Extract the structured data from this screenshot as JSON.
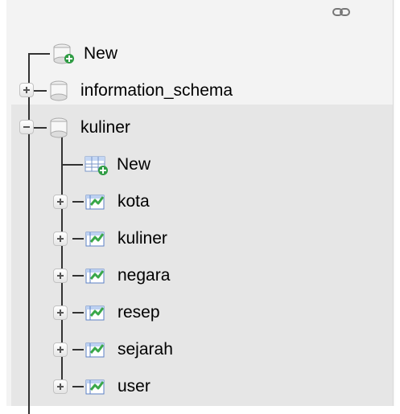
{
  "navigation_tree": {
    "link_icon": "link-chain-icon",
    "server_items": [
      {
        "label": "New",
        "icon": "new-database-icon"
      },
      {
        "label": "information_schema",
        "icon": "database-icon",
        "expander": "expand-plus"
      },
      {
        "label": "kuliner",
        "icon": "database-icon",
        "expander": "collapse-minus"
      }
    ],
    "database_items": [
      {
        "label": "New",
        "icon": "new-table-icon"
      },
      {
        "label": "kota",
        "icon": "table-icon",
        "expander": "expand-plus"
      },
      {
        "label": "kuliner",
        "icon": "table-icon",
        "expander": "expand-plus"
      },
      {
        "label": "negara",
        "icon": "table-icon",
        "expander": "expand-plus"
      },
      {
        "label": "resep",
        "icon": "table-icon",
        "expander": "expand-plus"
      },
      {
        "label": "sejarah",
        "icon": "table-icon",
        "expander": "expand-plus"
      },
      {
        "label": "user",
        "icon": "table-icon",
        "expander": "expand-plus"
      }
    ],
    "colors": {
      "panel_background": "#f3f3f3",
      "selected_database_background": "#e6e6e6",
      "tree_line": "#333333",
      "table_icon_green": "#3aa84a",
      "table_icon_blue": "#3f73c7"
    }
  }
}
